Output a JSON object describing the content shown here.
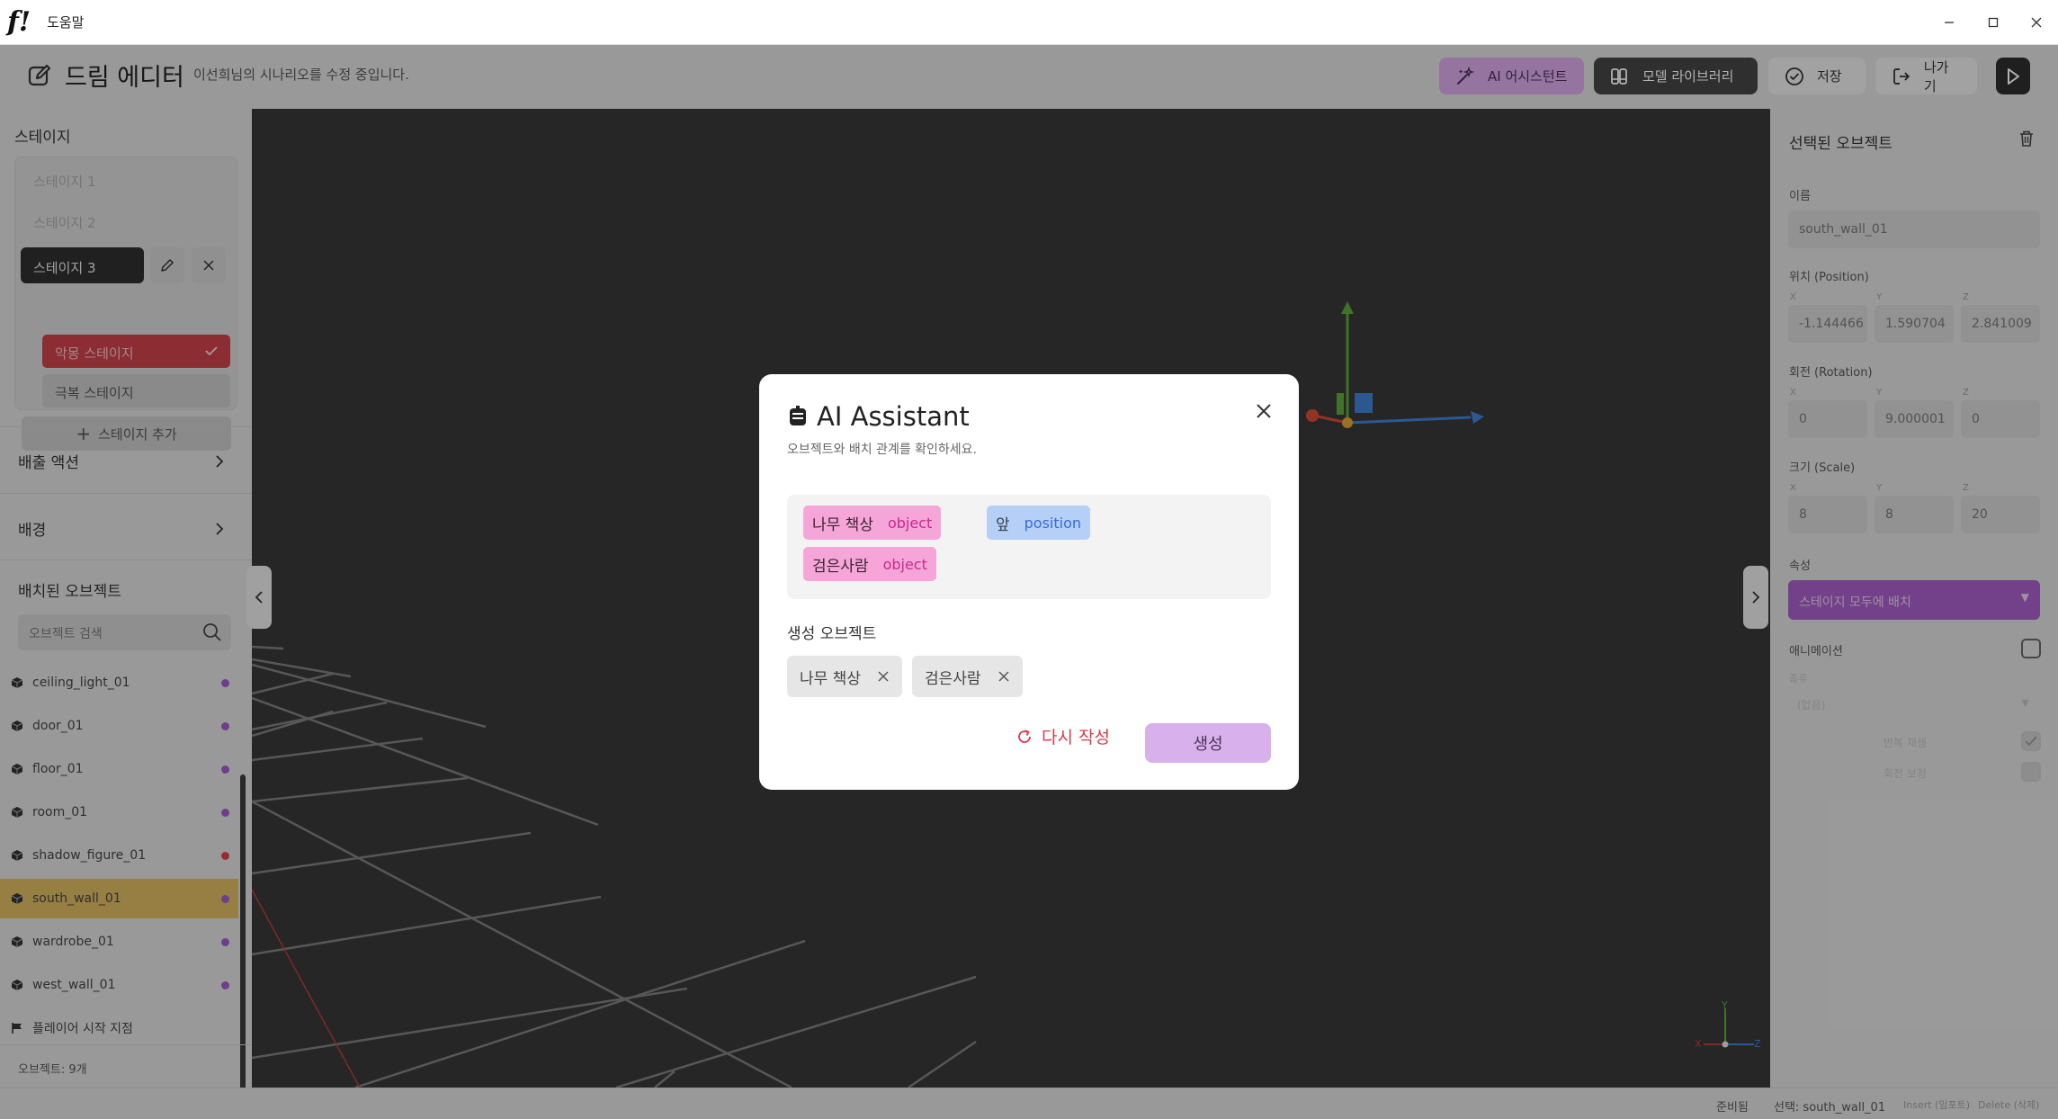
{
  "window": {
    "logo": "f!",
    "title": "도움말"
  },
  "toolbar": {
    "title": "드림 에디터",
    "subtitle": "이선희님의 시나리오를 수정 중입니다.",
    "ai_label": "AI 어시스턴트",
    "library_label": "모델 라이브러리",
    "save_label": "저장",
    "exit_label": "나가기"
  },
  "sidebar": {
    "stages_title": "스테이지",
    "stages": [
      "스테이지 1",
      "스테이지 2",
      "스테이지 3"
    ],
    "sub_stages": [
      "악몽 스테이지",
      "극복 스테이지"
    ],
    "add_stage": "스테이지 추가",
    "exit_action": "배출 액션",
    "background": "배경",
    "objects_title": "배치된 오브젝트",
    "search_placeholder": "오브젝트 검색",
    "objects": [
      {
        "name": "ceiling_light_01",
        "dot": "#9b59c8"
      },
      {
        "name": "door_01",
        "dot": "#9b59c8"
      },
      {
        "name": "floor_01",
        "dot": "#9b59c8"
      },
      {
        "name": "room_01",
        "dot": "#9b59c8"
      },
      {
        "name": "shadow_figure_01",
        "dot": "#d9404d"
      },
      {
        "name": "south_wall_01",
        "dot": "#9b59c8"
      },
      {
        "name": "wardrobe_01",
        "dot": "#9b59c8"
      },
      {
        "name": "west_wall_01",
        "dot": "#9b59c8"
      }
    ],
    "player_start": "플레이어 시작 지점",
    "object_count": "오브젝트: 9개"
  },
  "inspector": {
    "title": "선택된 오브젝트",
    "name_label": "이름",
    "name_value": "south_wall_01",
    "position_label": "위치 (Position)",
    "position": [
      "-1.144466",
      "1.590704",
      "2.841009"
    ],
    "rotation_label": "회전 (Rotation)",
    "rotation": [
      "0",
      "9.000001",
      "0"
    ],
    "scale_label": "크기 (Scale)",
    "scale": [
      "8",
      "8",
      "20"
    ],
    "axes": [
      "X",
      "Y",
      "Z"
    ],
    "attr_label": "속성",
    "attr_value": "스테이지 모두에 배치",
    "animation_label": "애니메이션",
    "anim_type_label": "종류",
    "anim_type_value": "(없음)",
    "loop_label": "반복 재생",
    "rotate_label": "회전 보정"
  },
  "viewport": {
    "axis_x": "X",
    "axis_y": "Y",
    "axis_z": "Z"
  },
  "status": {
    "ready": "준비됨",
    "selection": "선택: south_wall_01",
    "insert_hint": "Insert (임포트)",
    "delete_hint": "Delete (삭제)"
  },
  "modal": {
    "title": "AI Assistant",
    "subtitle": "오브젝트와 배치 관계를 확인하세요.",
    "tags": [
      {
        "text": "나무 책상",
        "kind": "object"
      },
      {
        "text": "앞",
        "kind": "position"
      },
      {
        "text": "검은사람",
        "kind": "object"
      }
    ],
    "generated_label": "생성 오브젝트",
    "generated": [
      "나무 책상",
      "검은사람"
    ],
    "retry_label": "다시 작성",
    "generate_label": "생성"
  }
}
